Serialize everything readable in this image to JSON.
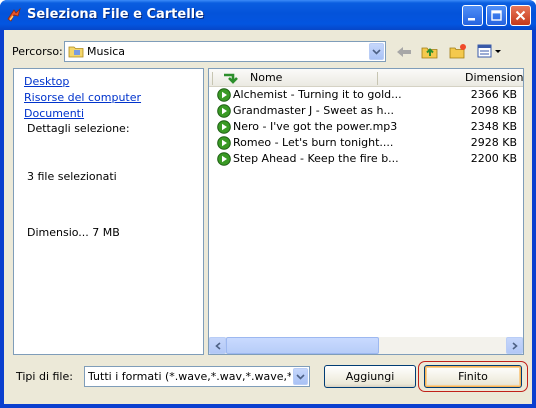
{
  "window": {
    "title": "Seleziona File e Cartelle"
  },
  "path": {
    "label": "Percorso:",
    "value": "Musica"
  },
  "left_pane": {
    "links": [
      "Desktop",
      "Risorse del computer",
      "Documenti"
    ],
    "details_label": "Dettagli selezione:",
    "selected_count": "3 file selezionati",
    "size_text": "Dimensio...  7 MB"
  },
  "columns": {
    "name": "Nome",
    "size": "Dimensione"
  },
  "files": [
    {
      "name": "Alchemist - Turning it to gold...",
      "size": "2366 KB"
    },
    {
      "name": "Grandmaster J - Sweet as h...",
      "size": "2098 KB"
    },
    {
      "name": "Nero -  I've got the power.mp3",
      "size": "2348 KB"
    },
    {
      "name": "Romeo -  Let's burn tonight....",
      "size": "2928 KB"
    },
    {
      "name": "Step Ahead - Keep the fire b...",
      "size": "2200 KB"
    }
  ],
  "filter": {
    "label": "Tipi di file:",
    "value": "Tutti i formati  (*.wave,*.wav,*.wave,*.wav,*"
  },
  "buttons": {
    "add": "Aggiungi",
    "finish": "Finito"
  },
  "colors": {
    "title_bar": "#0453da",
    "dialog_bg": "#ece9d8",
    "link": "#0033cc",
    "highlight": "#c0201a"
  },
  "icons": {
    "title": "app-icon",
    "folder": "folder-icon",
    "back": "back-arrow-icon",
    "up": "up-folder-icon",
    "new_folder": "new-folder-icon",
    "views": "views-icon",
    "sort": "sort-arrow-icon",
    "file": "audio-file-icon"
  }
}
